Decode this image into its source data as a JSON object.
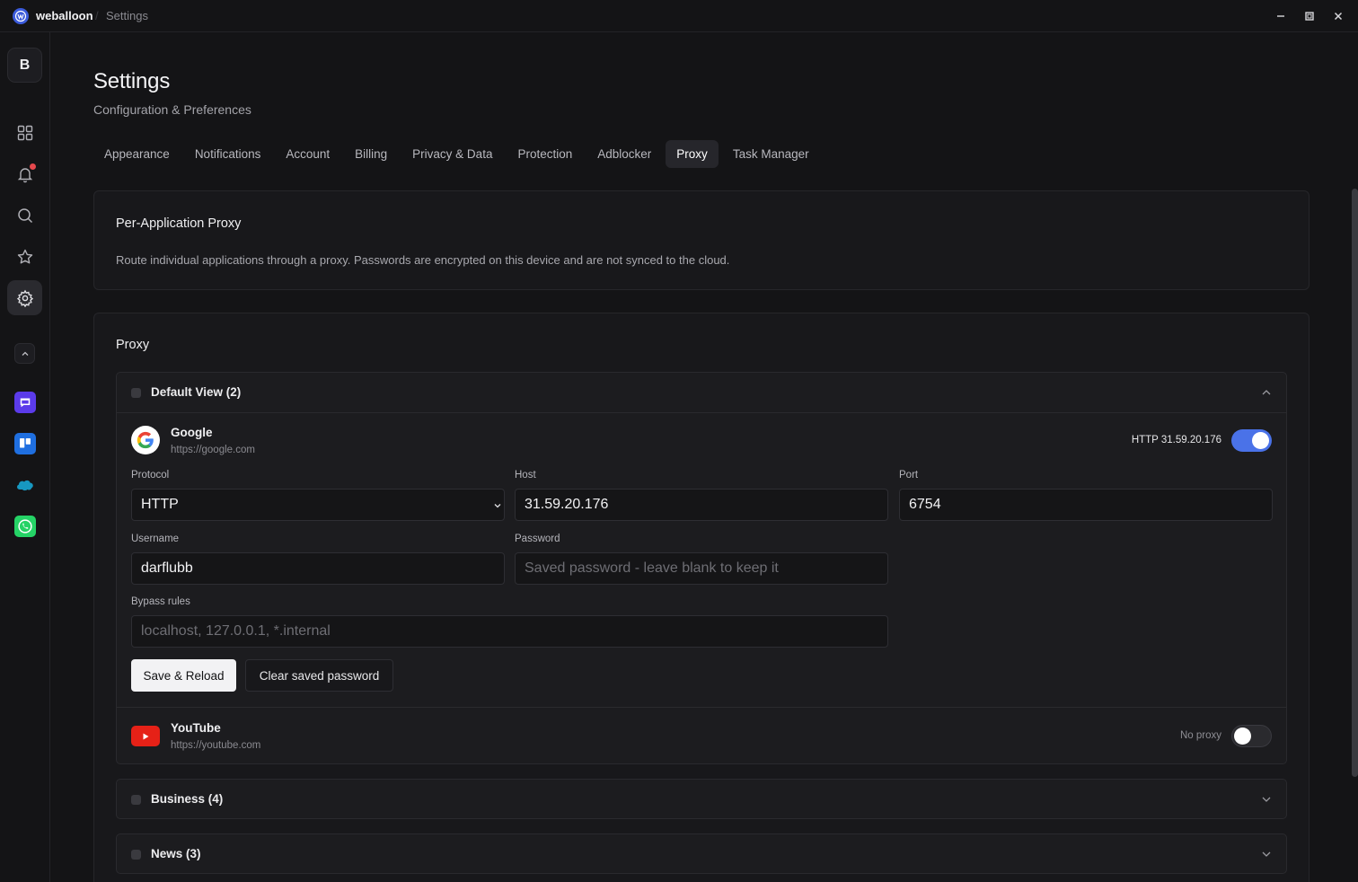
{
  "app": {
    "name": "weballoon",
    "separator": "/",
    "page": "Settings"
  },
  "window_controls": [
    "minimize-icon",
    "maximize-icon",
    "close-icon"
  ],
  "sidebar": {
    "profile_initial": "B",
    "nav": [
      {
        "name": "dashboard-grid-icon"
      },
      {
        "name": "bell-icon",
        "has_badge": true
      },
      {
        "name": "search-icon"
      },
      {
        "name": "star-icon"
      },
      {
        "name": "gear-icon",
        "active": true
      }
    ],
    "apps": [
      {
        "name": "chat-app-icon",
        "color": "#5b3bea"
      },
      {
        "name": "trello-icon",
        "color": "#1f6fe0"
      },
      {
        "name": "salesforce-icon",
        "color": "#1798c1"
      },
      {
        "name": "whatsapp-icon",
        "color": "#25d366"
      }
    ]
  },
  "header": {
    "title": "Settings",
    "subtitle": "Configuration & Preferences"
  },
  "tabs": [
    {
      "label": "Appearance"
    },
    {
      "label": "Notifications"
    },
    {
      "label": "Account"
    },
    {
      "label": "Billing"
    },
    {
      "label": "Privacy & Data"
    },
    {
      "label": "Protection"
    },
    {
      "label": "Adblocker"
    },
    {
      "label": "Proxy",
      "active": true
    },
    {
      "label": "Task Manager"
    }
  ],
  "intro_card": {
    "title": "Per-Application Proxy",
    "description": "Route individual applications through a proxy. Passwords are encrypted on this device and are not synced to the cloud."
  },
  "proxy_card": {
    "title": "Proxy",
    "groups": [
      {
        "title": "Default View (2)",
        "expanded": true,
        "sites": [
          {
            "name": "Google",
            "url": "https://google.com",
            "status": "HTTP 31.59.20.176",
            "enabled": true,
            "form": {
              "protocol_label": "Protocol",
              "protocol_value": "HTTP",
              "host_label": "Host",
              "host_value": "31.59.20.176",
              "port_label": "Port",
              "port_value": "6754",
              "username_label": "Username",
              "username_value": "darflubb",
              "password_label": "Password",
              "password_placeholder": "Saved password - leave blank to keep it",
              "bypass_label": "Bypass rules",
              "bypass_placeholder": "localhost, 127.0.0.1, *.internal",
              "save_label": "Save & Reload",
              "clear_label": "Clear saved password"
            }
          },
          {
            "name": "YouTube",
            "url": "https://youtube.com",
            "status": "No proxy",
            "enabled": false
          }
        ]
      },
      {
        "title": "Business (4)",
        "expanded": false
      },
      {
        "title": "News (3)",
        "expanded": false
      }
    ]
  },
  "colors": {
    "background": "#141416",
    "accent": "#4a72e8",
    "notification": "#e5484d",
    "youtube": "#e62117"
  }
}
